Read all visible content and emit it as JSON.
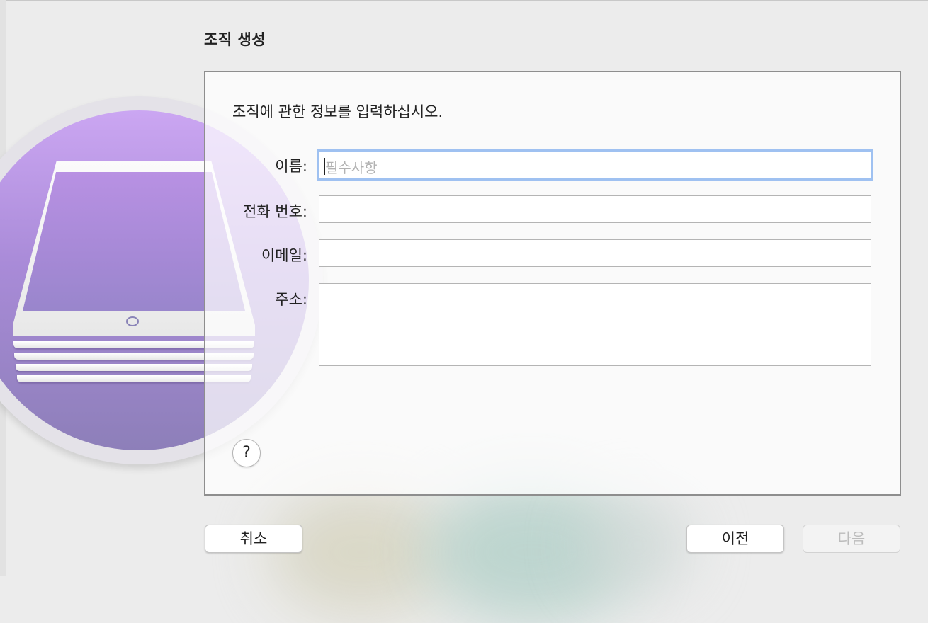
{
  "dialog": {
    "title": "조직 생성",
    "prompt": "조직에 관한 정보를 입력하십시오."
  },
  "form": {
    "name_label": "이름:",
    "name_value": "",
    "name_placeholder": "필수사항",
    "phone_label": "전화 번호:",
    "phone_value": "",
    "email_label": "이메일:",
    "email_value": "",
    "address_label": "주소:",
    "address_value": ""
  },
  "help": {
    "label": "?"
  },
  "buttons": {
    "cancel": "취소",
    "previous": "이전",
    "next": "다음",
    "next_enabled": false
  },
  "colors": {
    "focus_ring": "#9fc1f1",
    "badge_purple": "#a98bd8"
  },
  "icons": {
    "illustration": "stacked-ipads-icon"
  }
}
